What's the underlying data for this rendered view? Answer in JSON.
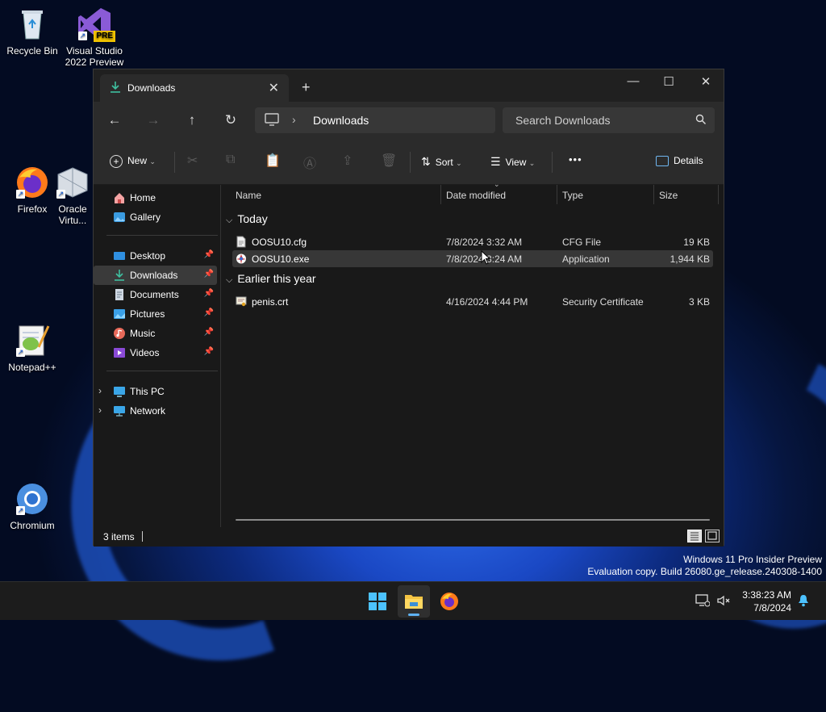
{
  "desktop": {
    "icons": [
      {
        "label": "Recycle Bin"
      },
      {
        "label": "Visual Studio 2022 Preview",
        "badge": "PRE"
      },
      {
        "label": "Firefox"
      },
      {
        "label": "Oracle Virtu..."
      },
      {
        "label": "Notepad++"
      },
      {
        "label": "Chromium"
      }
    ],
    "watermark": {
      "line1": "Windows 11 Pro Insider Preview",
      "line2": "Evaluation copy. Build 26080.ge_release.240308-1400"
    }
  },
  "explorer": {
    "tab_title": "Downloads",
    "new_tab_glyph": "+",
    "address": {
      "location": "Downloads"
    },
    "search": {
      "placeholder": "Search Downloads"
    },
    "commands": {
      "new": "New",
      "sort": "Sort",
      "view": "View",
      "more": "•••",
      "details": "Details"
    },
    "sidebar": {
      "quick": [
        {
          "label": "Home",
          "icon": "home-icon"
        },
        {
          "label": "Gallery",
          "icon": "gallery-icon"
        }
      ],
      "pinned": [
        {
          "label": "Desktop",
          "icon": "desktop-folder-icon",
          "selected": false
        },
        {
          "label": "Downloads",
          "icon": "download-icon",
          "selected": true
        },
        {
          "label": "Documents",
          "icon": "documents-icon",
          "selected": false
        },
        {
          "label": "Pictures",
          "icon": "pictures-icon",
          "selected": false
        },
        {
          "label": "Music",
          "icon": "music-icon",
          "selected": false
        },
        {
          "label": "Videos",
          "icon": "videos-icon",
          "selected": false
        }
      ],
      "locations": [
        {
          "label": "This PC",
          "icon": "this-pc-icon"
        },
        {
          "label": "Network",
          "icon": "network-icon"
        }
      ]
    },
    "columns": {
      "name": "Name",
      "date": "Date modified",
      "type": "Type",
      "size": "Size"
    },
    "groups": [
      {
        "label": "Today",
        "files": [
          {
            "name": "OOSU10.cfg",
            "date": "7/8/2024 3:32 AM",
            "type": "CFG File",
            "size": "19 KB",
            "icon": "text-file-icon",
            "selected": false
          },
          {
            "name": "OOSU10.exe",
            "date": "7/8/2024 3:24 AM",
            "type": "Application",
            "size": "1,944 KB",
            "icon": "application-icon",
            "selected": true
          }
        ]
      },
      {
        "label": "Earlier this year",
        "files": [
          {
            "name": "penis.crt",
            "date": "4/16/2024 4:44 PM",
            "type": "Security Certificate",
            "size": "3 KB",
            "icon": "certificate-icon",
            "selected": false
          }
        ]
      }
    ],
    "status": {
      "item_count": "3 items"
    }
  },
  "taskbar": {
    "clock": {
      "time": "3:38:23 AM",
      "date": "7/8/2024"
    }
  }
}
